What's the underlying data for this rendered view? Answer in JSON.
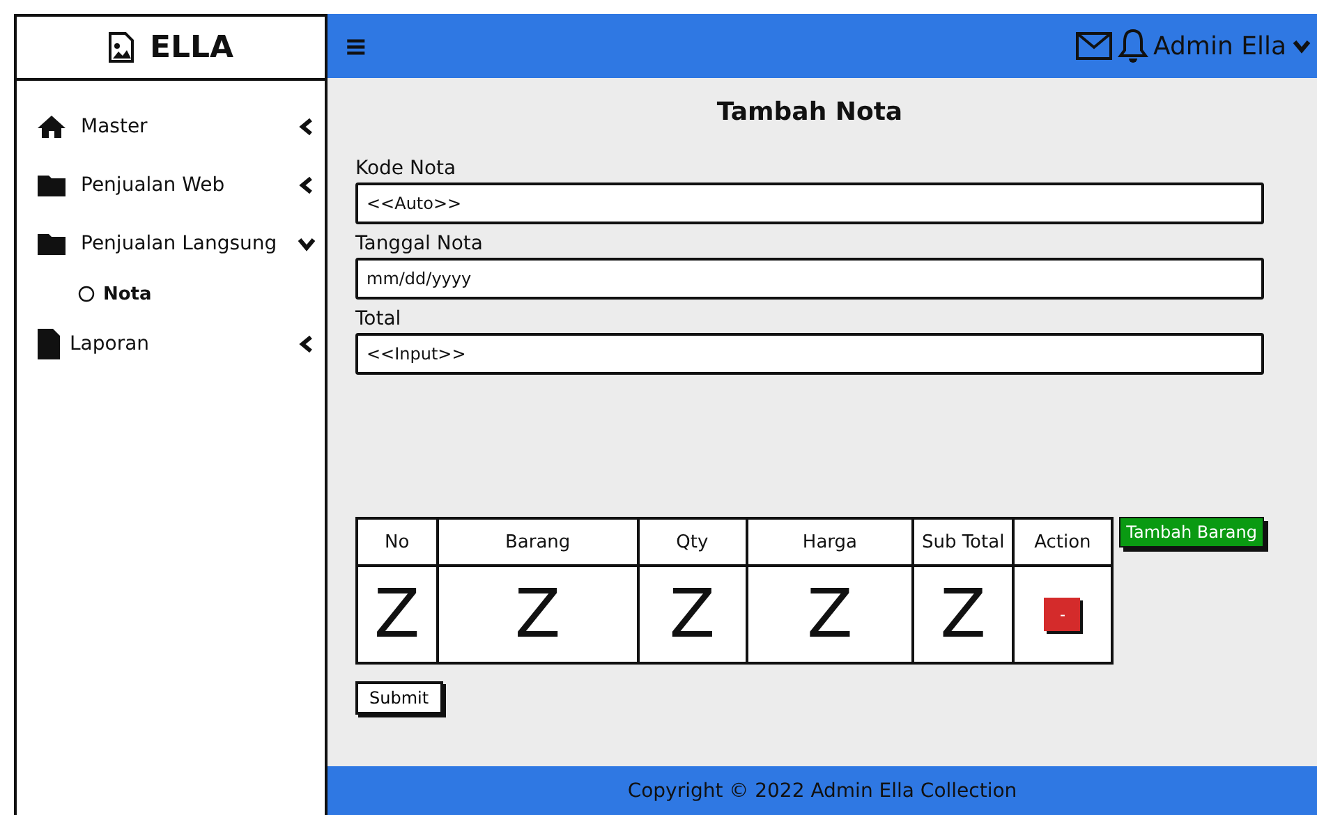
{
  "brand": {
    "title": "ELLA"
  },
  "sidebar": {
    "items": [
      {
        "label": "Master",
        "kind": "home",
        "expanded": false
      },
      {
        "label": "Penjualan Web",
        "kind": "folder",
        "expanded": false
      },
      {
        "label": "Penjualan Langsung",
        "kind": "folder",
        "expanded": true,
        "children": [
          {
            "label": "Nota"
          }
        ]
      },
      {
        "label": "Laporan",
        "kind": "file",
        "expanded": false
      }
    ]
  },
  "header": {
    "menu_icon": "≡",
    "user": "Admin Ella"
  },
  "form": {
    "title": "Tambah Nota",
    "fields": [
      {
        "label": "Kode Nota",
        "value": "<<Auto>>"
      },
      {
        "label": "Tanggal Nota",
        "value": "mm/dd/yyyy"
      },
      {
        "label": "Total",
        "value": "<<Input>>"
      }
    ]
  },
  "table": {
    "columns": [
      "No",
      "Barang",
      "Qty",
      "Harga",
      "Sub Total",
      "Action"
    ],
    "rows": [
      {
        "cells": [
          "Z",
          "Z",
          "Z",
          "Z",
          "Z"
        ],
        "action": "-"
      }
    ]
  },
  "add_button": "Tambah Barang",
  "submit_button": "Submit",
  "footer": "Copyright © 2022 Admin Ella Collection"
}
